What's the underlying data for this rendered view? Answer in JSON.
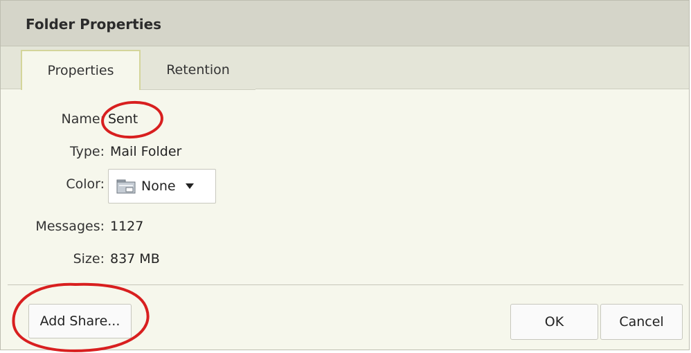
{
  "dialog": {
    "title": "Folder Properties"
  },
  "tabs": [
    {
      "label": "Properties",
      "active": true
    },
    {
      "label": "Retention",
      "active": false
    }
  ],
  "fields": {
    "name_label": "Name:",
    "name_value": "Sent",
    "type_label": "Type:",
    "type_value": "Mail Folder",
    "color_label": "Color:",
    "color_value": "None",
    "messages_label": "Messages:",
    "messages_value": "1127",
    "size_label": "Size:",
    "size_value": "837 MB"
  },
  "buttons": {
    "add_share": "Add Share...",
    "ok": "OK",
    "cancel": "Cancel"
  },
  "colors": {
    "annotation": "#d81f1f",
    "title_bar": "#d5d5c9",
    "panel": "#f6f7ec"
  },
  "icons": {
    "color_picker": "folder-icon",
    "dropdown": "caret-down-icon"
  }
}
